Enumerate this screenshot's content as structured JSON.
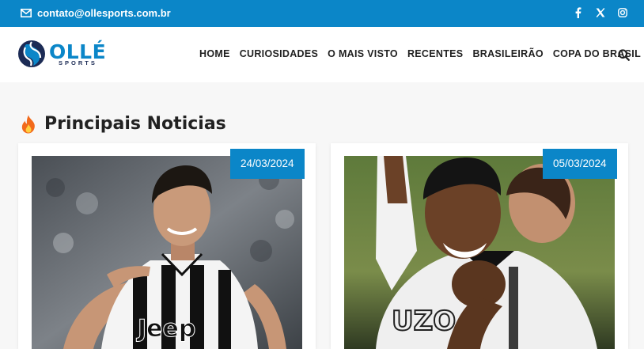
{
  "topbar": {
    "email": "contato@ollesports.com.br",
    "social_icons": [
      "facebook-icon",
      "x-twitter-icon",
      "instagram-icon"
    ]
  },
  "header": {
    "logo": {
      "brand": "OLLÉ",
      "sub": "SPORTS"
    },
    "nav": [
      "HOME",
      "CURIOSIDADES",
      "O MAIS VISTO",
      "RECENTES",
      "BRASILEIRÃO",
      "COPA DO BRASIL"
    ]
  },
  "main": {
    "section_title": "Principais Noticias",
    "cards": [
      {
        "date": "24/03/2024"
      },
      {
        "date": "05/03/2024"
      }
    ]
  },
  "colors": {
    "accent": "#0b86c8",
    "dark_text": "#222222",
    "fire": "#f26a1b"
  }
}
